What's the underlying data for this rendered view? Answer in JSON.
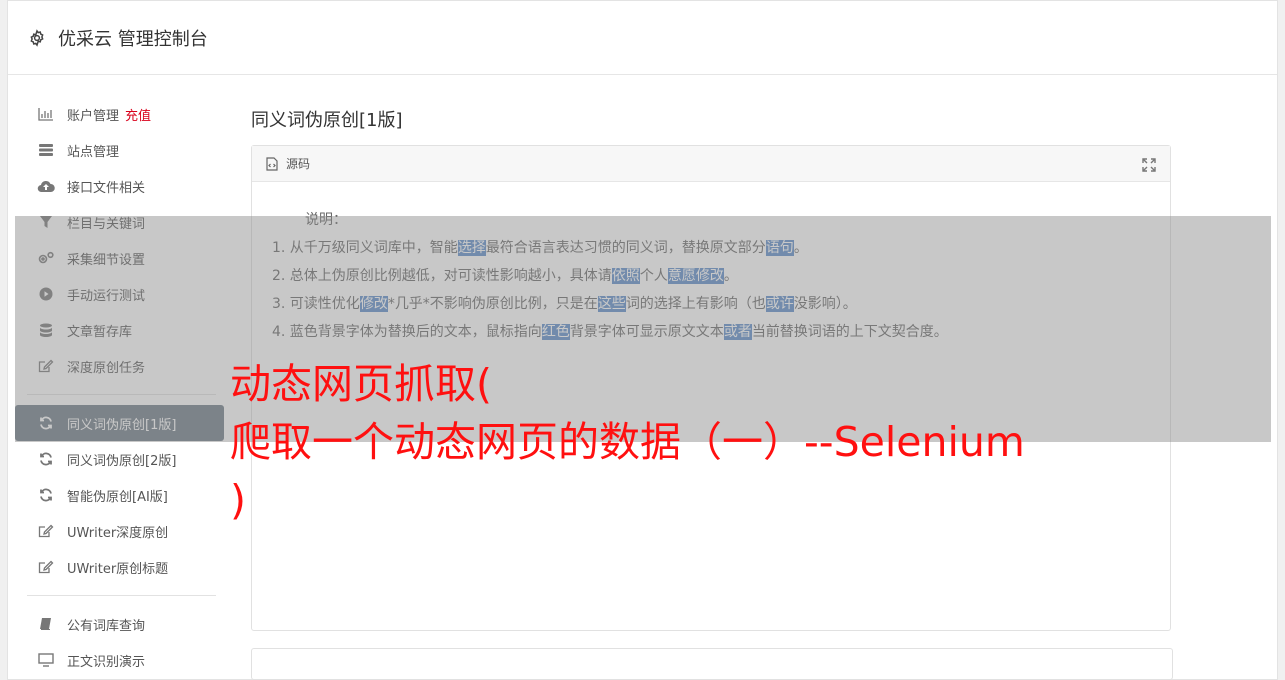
{
  "header": {
    "title": "优采云 管理控制台"
  },
  "sidebar": {
    "items": [
      {
        "label": "账户管理",
        "extra": "充值",
        "icon": "bar-chart-icon"
      },
      {
        "label": "站点管理",
        "icon": "server-icon"
      },
      {
        "label": "接口文件相关",
        "icon": "cloud-upload-icon"
      },
      {
        "label": "栏目与关键词",
        "icon": "filter-icon"
      },
      {
        "label": "采集细节设置",
        "icon": "gears-icon"
      },
      {
        "label": "手动运行测试",
        "icon": "play-circle-icon"
      },
      {
        "label": "文章暂存库",
        "icon": "database-icon"
      },
      {
        "label": "深度原创任务",
        "icon": "edit-icon"
      }
    ],
    "items2": [
      {
        "label": "同义词伪原创[1版]",
        "icon": "refresh-icon",
        "active": true
      },
      {
        "label": "同义词伪原创[2版]",
        "icon": "refresh-icon"
      },
      {
        "label": "智能伪原创[AI版]",
        "icon": "refresh-icon"
      },
      {
        "label": "UWriter深度原创",
        "icon": "edit-icon"
      },
      {
        "label": "UWriter原创标题",
        "icon": "edit-icon"
      }
    ],
    "items3": [
      {
        "label": "公有词库查询",
        "icon": "book-icon"
      },
      {
        "label": "正文识别演示",
        "icon": "screen-icon"
      }
    ]
  },
  "main": {
    "title": "同义词伪原创[1版]",
    "panel_label": "源码",
    "notes_head": "说明：",
    "notes": [
      [
        {
          "t": "1. 从千万级同义词库中，智能"
        },
        {
          "t": "选择",
          "h": true
        },
        {
          "t": "最符合语言表达习惯的同义词，替换原文部分"
        },
        {
          "t": "语句",
          "h": true
        },
        {
          "t": "。"
        }
      ],
      [
        {
          "t": "2. 总体上伪原创比例越低，对可读性影响越小，具体请"
        },
        {
          "t": "依照",
          "h": true
        },
        {
          "t": "个人"
        },
        {
          "t": "意愿",
          "h": true
        },
        {
          "t": "修改",
          "h": true
        },
        {
          "t": "。"
        }
      ],
      [
        {
          "t": "3. 可读性优化"
        },
        {
          "t": "修改",
          "h": true
        },
        {
          "t": "*几乎*不影响伪原创比例，只是在"
        },
        {
          "t": "这些",
          "h": true
        },
        {
          "t": "词的选择上有影响（也"
        },
        {
          "t": "或许",
          "h": true
        },
        {
          "t": "没影响）。"
        }
      ],
      [
        {
          "t": "4. 蓝色背景字体为替换后的文本，鼠标指向"
        },
        {
          "t": "红色",
          "h": true
        },
        {
          "t": "背景字体可显示原文文本"
        },
        {
          "t": "或者",
          "h": true
        },
        {
          "t": "当前替换词语的上下文契合度。"
        }
      ]
    ]
  },
  "overlay": {
    "lines": [
      "动态网页抓取(",
      "爬取一个动态网页的数据（一）--Selenium",
      ")"
    ]
  },
  "colors": {
    "highlight": "#5b8bc9",
    "overlay_text": "#ff1010",
    "charge": "#d9001b",
    "active_nav": "#6e7b86"
  }
}
